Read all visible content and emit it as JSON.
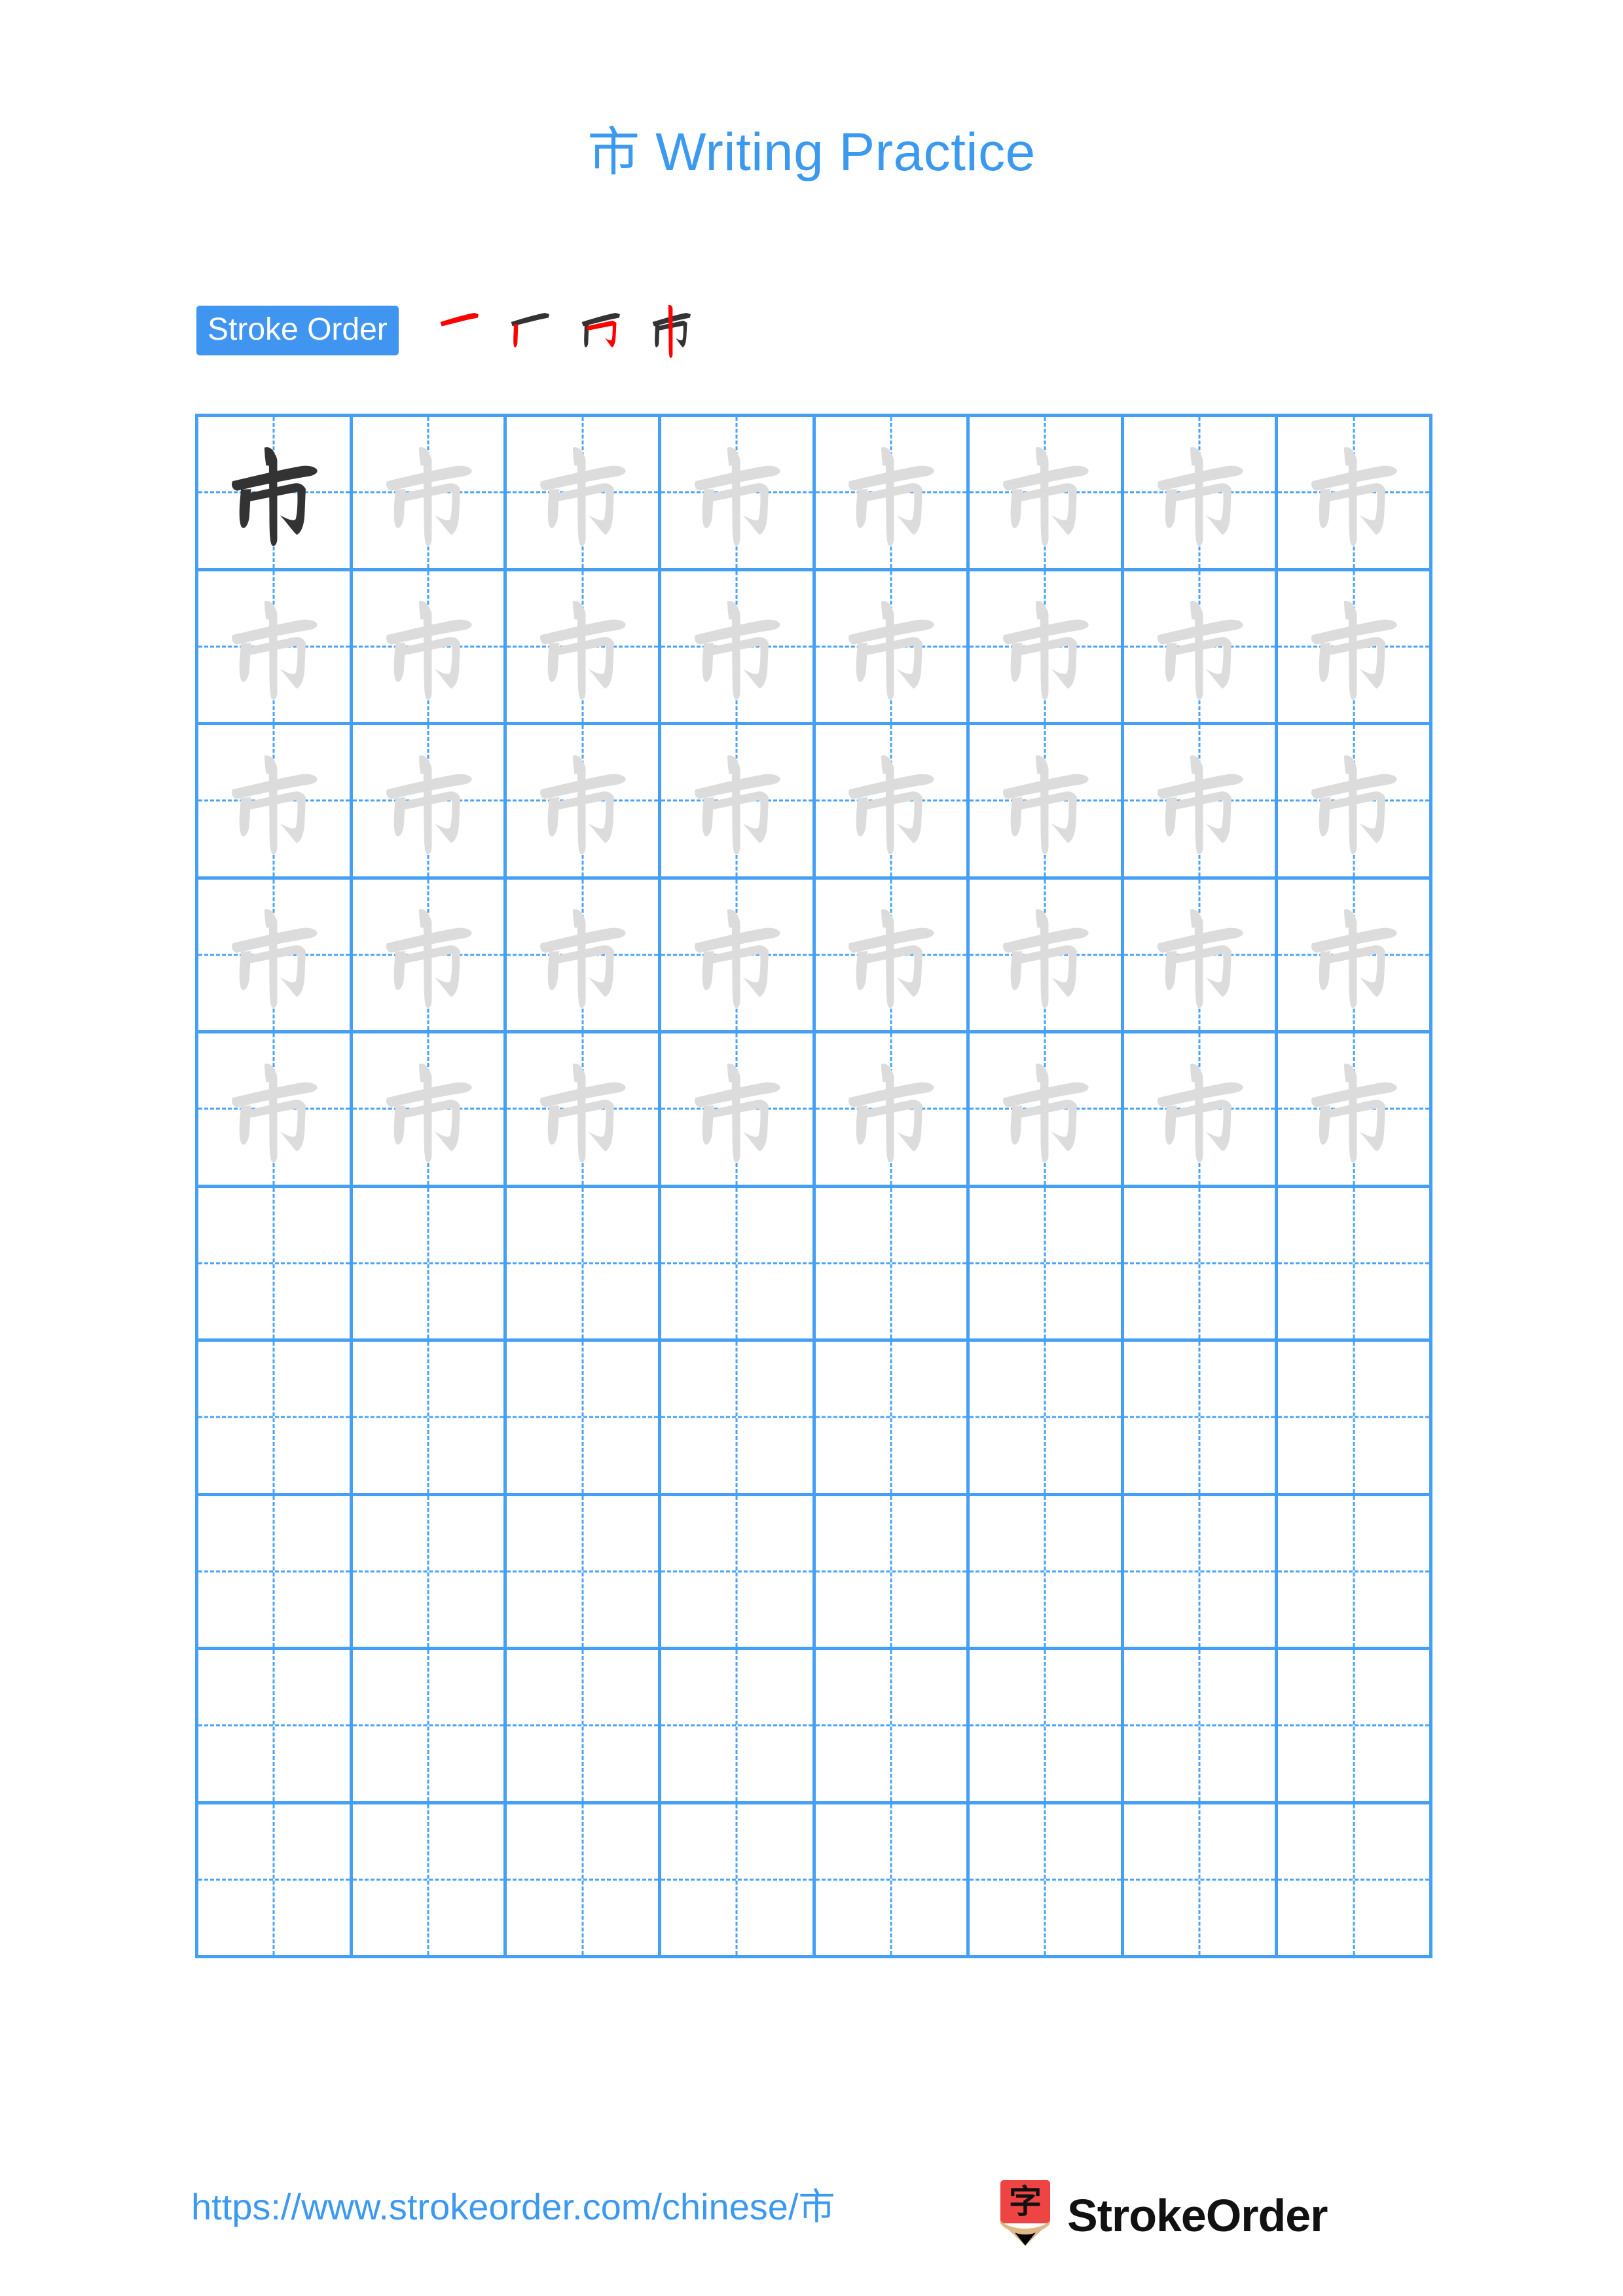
{
  "page": {
    "background_color": "#FFFFFF",
    "accent_blue": "#3B99F0",
    "grid_line_color": "#45A0F5",
    "guide_glyph_color": "#DCDCDC",
    "ink_color": "#333333",
    "stroke_highlight_color": "#FF0000"
  },
  "header": {
    "character": "市",
    "title_suffix": " Writing Practice",
    "full_title": "市 Writing Practice"
  },
  "stroke_order": {
    "badge_label": "Stroke Order",
    "badge_bg": "#4095F0",
    "badge_text_color": "#FFFFFF",
    "stroke_count": 4,
    "steps": [
      {
        "index": 1,
        "new_stroke": "héng (horizontal)",
        "strokes_shown": 1
      },
      {
        "index": 2,
        "new_stroke": "shù (left vertical)",
        "strokes_shown": 2
      },
      {
        "index": 3,
        "new_stroke": "héng zhé gōu (horizontal-bend-hook)",
        "strokes_shown": 3
      },
      {
        "index": 4,
        "new_stroke": "shù (center vertical)",
        "strokes_shown": 4
      }
    ]
  },
  "practice_grid": {
    "columns": 8,
    "rows": 10,
    "cell_style": "tian-zi-ge with dashed cross guides",
    "rows_data": [
      [
        "dark",
        "light",
        "light",
        "light",
        "light",
        "light",
        "light",
        "light"
      ],
      [
        "light",
        "light",
        "light",
        "light",
        "light",
        "light",
        "light",
        "light"
      ],
      [
        "light",
        "light",
        "light",
        "light",
        "light",
        "light",
        "light",
        "light"
      ],
      [
        "light",
        "light",
        "light",
        "light",
        "light",
        "light",
        "light",
        "light"
      ],
      [
        "light",
        "light",
        "light",
        "light",
        "light",
        "light",
        "light",
        "light"
      ],
      [
        "empty",
        "empty",
        "empty",
        "empty",
        "empty",
        "empty",
        "empty",
        "empty"
      ],
      [
        "empty",
        "empty",
        "empty",
        "empty",
        "empty",
        "empty",
        "empty",
        "empty"
      ],
      [
        "empty",
        "empty",
        "empty",
        "empty",
        "empty",
        "empty",
        "empty",
        "empty"
      ],
      [
        "empty",
        "empty",
        "empty",
        "empty",
        "empty",
        "empty",
        "empty",
        "empty"
      ],
      [
        "empty",
        "empty",
        "empty",
        "empty",
        "empty",
        "empty",
        "empty",
        "empty"
      ]
    ]
  },
  "footer": {
    "url_text": "https://www.strokeorder.com/chinese/市",
    "url_color": "#3B99F0",
    "brand_name": "StrokeOrder",
    "logo_character": "字",
    "logo_body_color": "#EF4444",
    "logo_wood_color": "#DEB887",
    "logo_tip_color": "#000000"
  }
}
